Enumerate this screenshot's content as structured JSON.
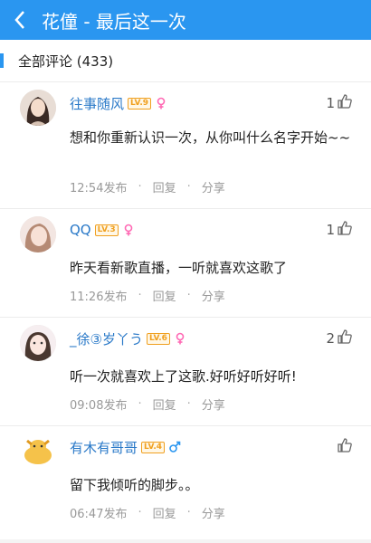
{
  "header": {
    "title": "花僮 - 最后这一次"
  },
  "section": {
    "label": "全部评论 (433)"
  },
  "comments": [
    {
      "username": "往事随风",
      "level": "LV.9",
      "gender": "female",
      "likes": "1",
      "text": "想和你重新认识一次，从你叫什么名字开始~~",
      "time": "12:54发布",
      "reply": "回复",
      "share": "分享"
    },
    {
      "username": "QQ",
      "level": "LV.3",
      "gender": "female",
      "likes": "1",
      "text": "昨天看新歌直播，一听就喜欢这歌了",
      "time": "11:26发布",
      "reply": "回复",
      "share": "分享"
    },
    {
      "username": "_徐③岁丫う",
      "level": "LV.6",
      "gender": "female",
      "likes": "2",
      "text": "听一次就喜欢上了这歌.好听好听好听!",
      "time": "09:08发布",
      "reply": "回复",
      "share": "分享"
    },
    {
      "username": "有木有哥哥",
      "level": "LV.4",
      "gender": "male",
      "likes": "",
      "text": "留下我倾听的脚步。。",
      "time": "06:47发布",
      "reply": "回复",
      "share": "分享"
    }
  ],
  "colors": {
    "accent": "#2a96f0",
    "username": "#2a79c8",
    "badge": "#f0a020",
    "female": "#ff69b4",
    "male": "#2a96f0"
  },
  "icons": {
    "back": "chevron-left-icon",
    "like": "thumbs-up-icon",
    "female": "female-icon",
    "male": "male-icon"
  }
}
